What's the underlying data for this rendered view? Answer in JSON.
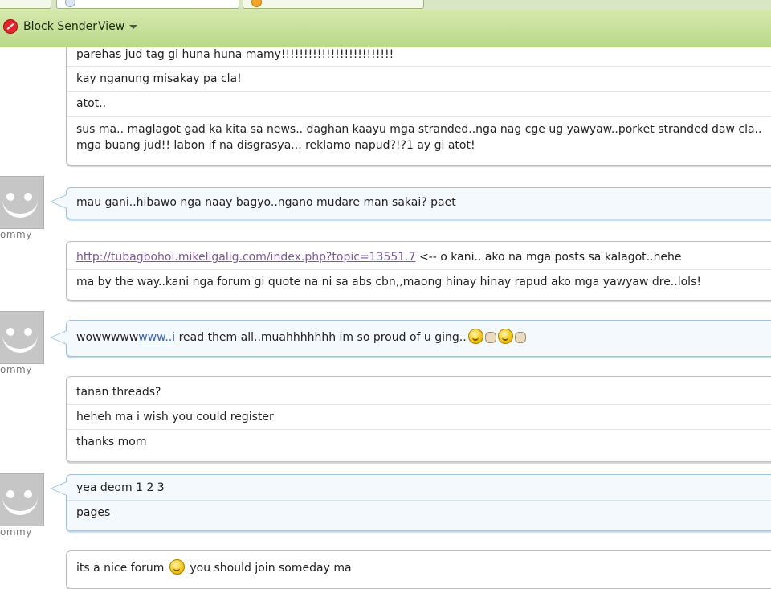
{
  "toolbar": {
    "block_sender": "Block Sender",
    "view": "View"
  },
  "messages": {
    "m1": [
      "parehas jud tag gi huna huna mamy!!!!!!!!!!!!!!!!!!!!!!!!!",
      "kay nganung misakay pa cla!",
      "atot..",
      "sus ma.. maglagot gad ka kita sa news.. daghan kaayu mga stranded..nga nag cge ug yawyaw..porket stranded daw cla.. mga buang jud!! labon if na disgrasya... reklamo napud?!?1 ay gi atot!"
    ],
    "m2": [
      "mau gani..hibawo nga naay bagyo..ngano mudare man sakai? paet"
    ],
    "m3": {
      "link": "http://tubagbohol.mikeligalig.com/index.php?topic=13551.7",
      "after_link": " <-- o kani.. ako na mga posts sa kalagot..hehe",
      "line2": "ma by the way..kani nga forum gi quote na ni sa abs cbn,,maong hinay hinay rapud ako mga yawyaw dre..lols!"
    },
    "m4": {
      "before": "wowwwww",
      "link": "www..i",
      "after": " read them all..muahhhhhhh im so proud of u ging.."
    },
    "m5": [
      "tanan threads?",
      "heheh ma i wish you could register",
      "thanks mom"
    ],
    "m6": [
      "yea deom 1 2 3",
      "pages"
    ],
    "m7": {
      "before": "its a nice forum ",
      "after": " you should join someday ma"
    }
  },
  "sender_name": "ommy",
  "icons": {
    "block": "block-icon",
    "avatar": "default-avatar-icon",
    "emoticon": "smiley-icon"
  }
}
